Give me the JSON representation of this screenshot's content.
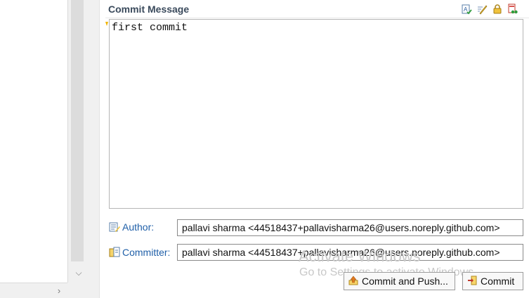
{
  "commit_message": {
    "title": "Commit Message",
    "text": "first commit",
    "toolbar": [
      {
        "icon": "spell-check-icon"
      },
      {
        "icon": "edit-pencil-icon"
      },
      {
        "icon": "lock-icon"
      },
      {
        "icon": "signed-off-icon"
      }
    ]
  },
  "author": {
    "label": "Author:",
    "value": "pallavi sharma <44518437+pallavisharma26@users.noreply.github.com>"
  },
  "committer": {
    "label": "Committer:",
    "value": "pallavi sharma <44518437+pallavisharma26@users.noreply.github.com>"
  },
  "buttons": {
    "commit_and_push": "Commit and Push...",
    "commit": "Commit"
  },
  "watermark": {
    "line1": "Activate Windows",
    "line2": "Go to Settings to activate Windows."
  },
  "colors": {
    "label_link": "#1f5fa8",
    "title_text": "#3a4a5c"
  }
}
